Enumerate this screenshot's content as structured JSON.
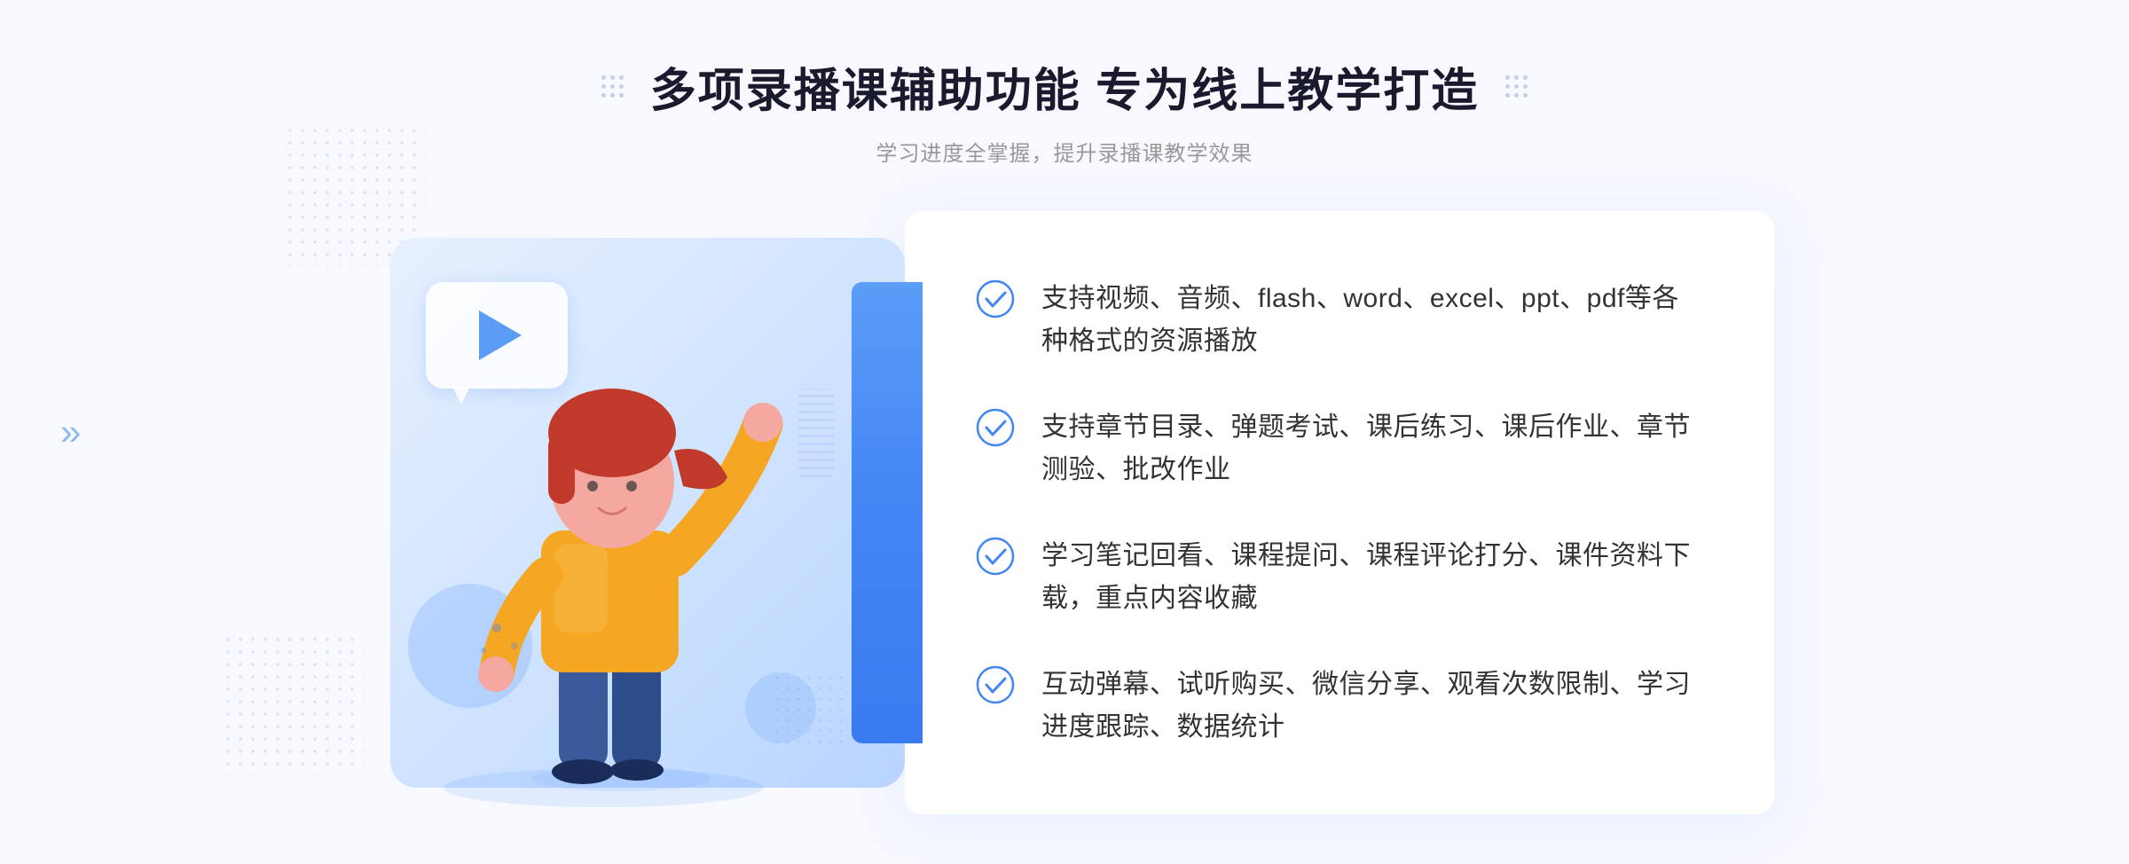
{
  "page": {
    "background": "#f8f9ff"
  },
  "header": {
    "title": "多项录播课辅助功能 专为线上教学打造",
    "subtitle": "学习进度全掌握，提升录播课教学效果"
  },
  "features": [
    {
      "id": 1,
      "text": "支持视频、音频、flash、word、excel、ppt、pdf等各种格式的资源播放"
    },
    {
      "id": 2,
      "text": "支持章节目录、弹题考试、课后练习、课后作业、章节测验、批改作业"
    },
    {
      "id": 3,
      "text": "学习笔记回看、课程提问、课程评论打分、课件资料下载，重点内容收藏"
    },
    {
      "id": 4,
      "text": "互动弹幕、试听购买、微信分享、观看次数限制、学习进度跟踪、数据统计"
    }
  ],
  "icons": {
    "play": "▶",
    "check": "✓",
    "chevron": "»"
  },
  "colors": {
    "primary": "#4285f4",
    "primary_light": "#5b9cf6",
    "text_dark": "#1a1a2e",
    "text_gray": "#999999",
    "text_body": "#333333",
    "bg_light": "#f8f9ff",
    "white": "#ffffff"
  }
}
